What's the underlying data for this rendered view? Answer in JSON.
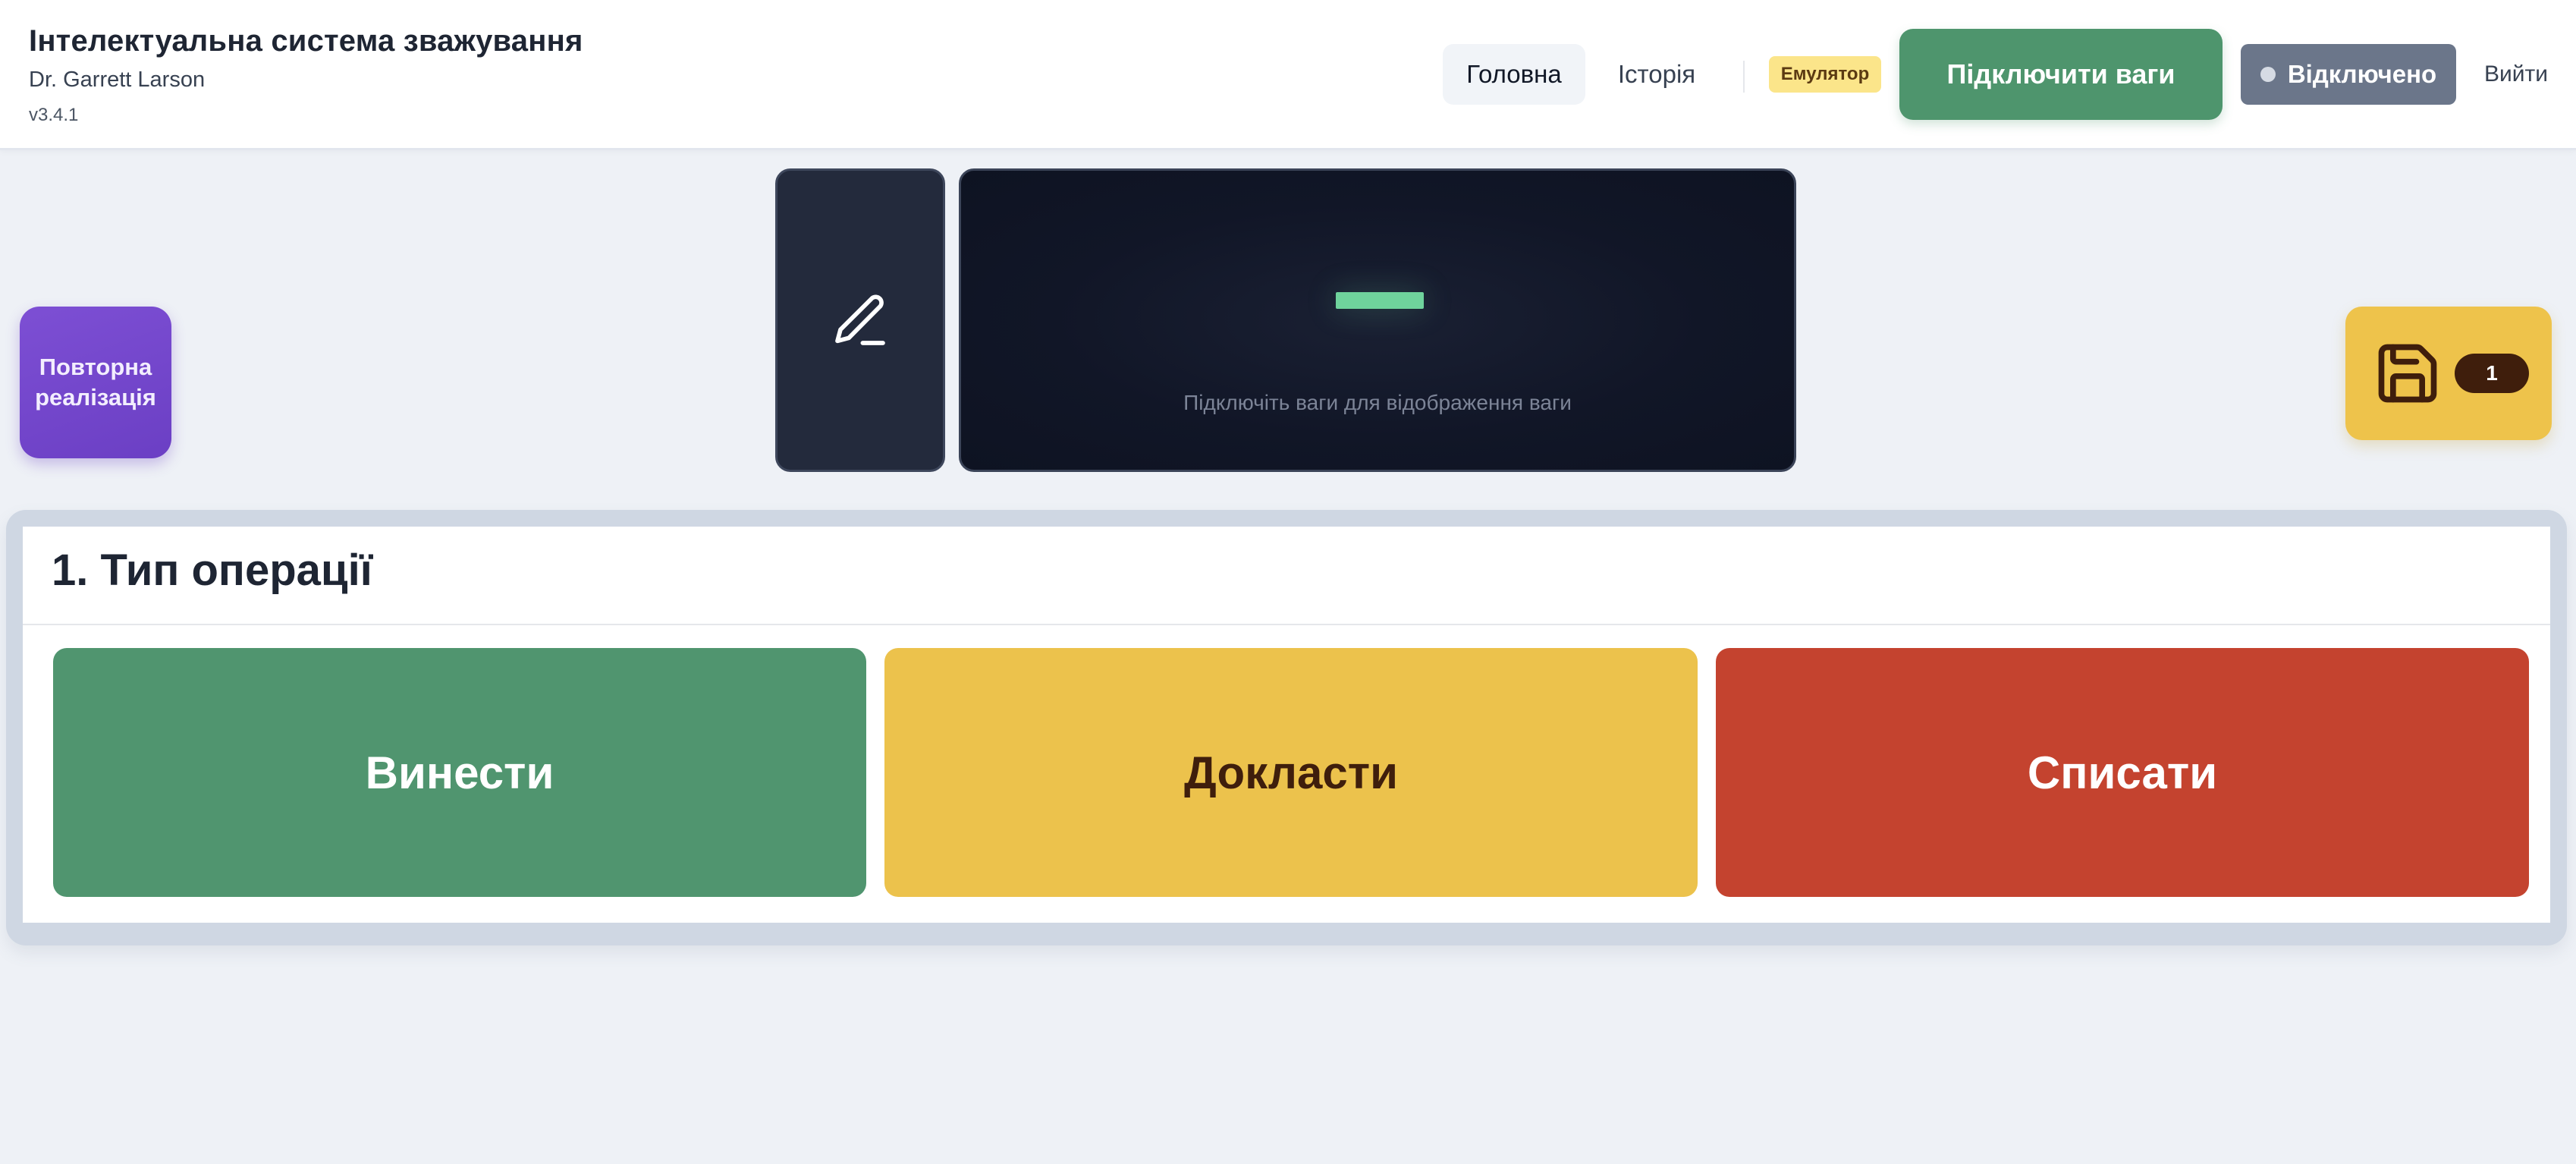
{
  "colors": {
    "accent_green": "#4e956d",
    "status_gray": "#6b768a",
    "purple": "#6b3fc4",
    "yellow": "#eec34b",
    "red": "#c4432f",
    "weight_dash": "#6fd39c"
  },
  "header": {
    "title": "Інтелектуальна система зважування",
    "user": "Dr. Garrett Larson",
    "version": "v3.4.1",
    "tabs": [
      {
        "label": "Головна",
        "active": true
      },
      {
        "label": "Історія",
        "active": false
      }
    ],
    "mode_badge": "Емулятор",
    "connect_button": "Підключити ваги",
    "status": "Відключено",
    "logout": "Вийти"
  },
  "left_action": {
    "label_line1": "Повторна",
    "label_line2": "реалізація"
  },
  "edit_panel": {
    "icon": "pencil-icon"
  },
  "weight_display": {
    "value": "—",
    "hint": "Підключіть ваги для відображення ваги"
  },
  "save": {
    "icon": "floppy-disk-icon",
    "count": "1"
  },
  "operation": {
    "title": "1. Тип операції",
    "options": [
      {
        "label": "Винести"
      },
      {
        "label": "Докласти"
      },
      {
        "label": "Списати"
      }
    ]
  }
}
